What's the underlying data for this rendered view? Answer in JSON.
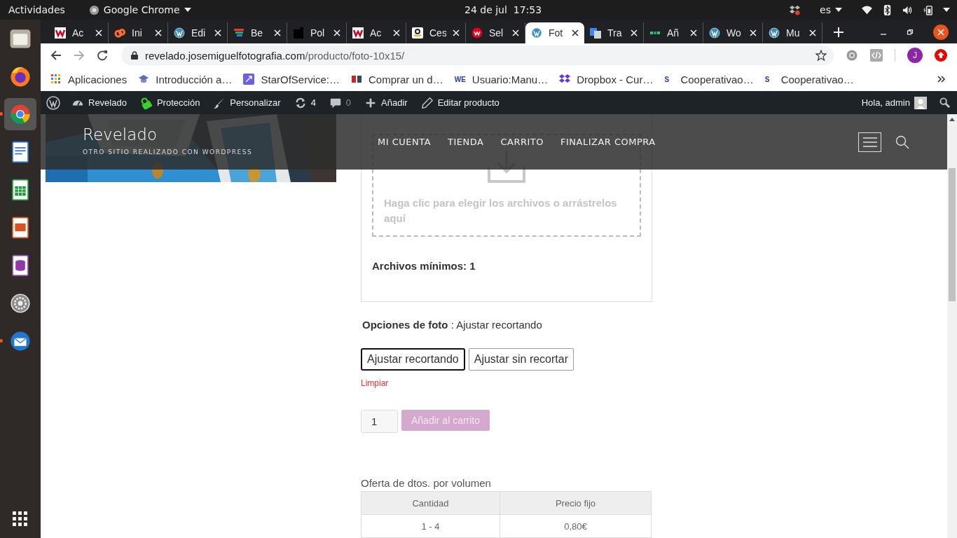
{
  "system_bar": {
    "activities": "Actividades",
    "app_menu": "Google Chrome",
    "clock": "24 de jul  17:53",
    "language": "es"
  },
  "dock": [
    {
      "kind": "files",
      "running": false,
      "selected": false
    },
    {
      "kind": "firefox",
      "running": false,
      "selected": false
    },
    {
      "kind": "chrome",
      "running": true,
      "selected": true
    },
    {
      "kind": "writer",
      "running": false,
      "selected": false
    },
    {
      "kind": "calc",
      "running": false,
      "selected": false
    },
    {
      "kind": "impress",
      "running": false,
      "selected": false
    },
    {
      "kind": "base",
      "running": false,
      "selected": false
    },
    {
      "kind": "settings",
      "running": false,
      "selected": false
    },
    {
      "kind": "mail",
      "running": true,
      "selected": false
    }
  ],
  "tabs": [
    {
      "title": "Ac",
      "kind": "wred",
      "selected": false
    },
    {
      "title": "Ini",
      "kind": "cpanel",
      "selected": false
    },
    {
      "title": "Edi",
      "kind": "wordpress",
      "selected": false
    },
    {
      "title": "Be",
      "kind": "rainbow",
      "selected": false
    },
    {
      "title": "Pol",
      "kind": "black",
      "selected": false
    },
    {
      "title": "Ac",
      "kind": "wred",
      "selected": false
    },
    {
      "title": "Ces",
      "kind": "amazon",
      "selected": false
    },
    {
      "title": "Sel",
      "kind": "redcircle",
      "selected": false
    },
    {
      "title": "Fot",
      "kind": "wordpress",
      "selected": true
    },
    {
      "title": "Tra",
      "kind": "translate",
      "selected": false
    },
    {
      "title": "Añ",
      "kind": "green",
      "selected": false
    },
    {
      "title": "Wo",
      "kind": "wordpress",
      "selected": false
    },
    {
      "title": "Mu",
      "kind": "wordpress",
      "selected": false
    }
  ],
  "address": {
    "host": "revelado.josemiguelfotografia.com",
    "path": "/producto/foto-10x15/"
  },
  "profile_initial": "J",
  "bookmarks": [
    {
      "label": "Aplicaciones",
      "kind": "apps"
    },
    {
      "label": "Introducción a…",
      "kind": "cap"
    },
    {
      "label": "StarOfService:…",
      "kind": "purple"
    },
    {
      "label": "Comprar un d…",
      "kind": "flags"
    },
    {
      "label": "Usuario:Manu…",
      "kind": "text",
      "badge": "WE"
    },
    {
      "label": "Dropbox - Cur…",
      "kind": "dropbox"
    },
    {
      "label": "Cooperativao…",
      "kind": "text",
      "badge": "S"
    },
    {
      "label": "Cooperativao…",
      "kind": "text",
      "badge": "S"
    }
  ],
  "admin_bar": {
    "items": [
      {
        "label": "Revelado",
        "kind": "dashboard"
      },
      {
        "label": "Protección",
        "kind": "lock"
      },
      {
        "label": "Personalizar",
        "kind": "brush"
      },
      {
        "label": "4",
        "kind": "updates"
      },
      {
        "label": "0",
        "kind": "comments"
      },
      {
        "label": "Añadir",
        "kind": "plus"
      },
      {
        "label": "Editar producto",
        "kind": "pencil"
      }
    ],
    "greeting": "Hola, admin"
  },
  "site": {
    "title": "Revelado",
    "tagline": "OTRO SITIO REALIZADO CON WORDPRESS",
    "nav": [
      "MI CUENTA",
      "TIENDA",
      "CARRITO",
      "FINALIZAR COMPRA"
    ]
  },
  "upload": {
    "hint": "Haga clic para elegir los archivos o arrástrelos aquí",
    "min_files": "Archivos mínimos: 1"
  },
  "option_line": "**Opciones de foto** : Ajustar recortando",
  "choices": [
    {
      "label": "Ajustar recortando",
      "selected": true
    },
    {
      "label": "Ajustar sin recortar",
      "selected": false
    }
  ],
  "clear_link": "Limpiar",
  "quantity": "1",
  "add_to_cart": {
    "label": "Añadir al carrito",
    "disabled": true
  },
  "discounts": {
    "title": "Oferta de dtos. por volumen",
    "columns": [
      "Cantidad",
      "Precio fijo"
    ],
    "rows": [
      [
        "1 - 4",
        "0,80€"
      ]
    ]
  }
}
